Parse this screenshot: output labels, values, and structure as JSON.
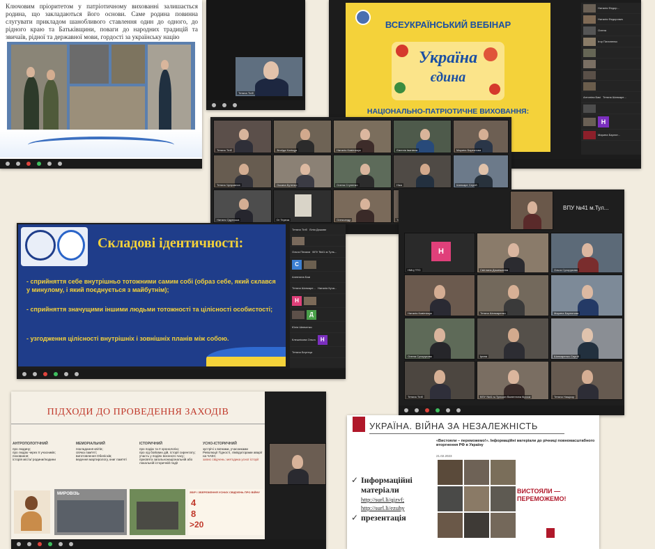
{
  "shot1": {
    "paragraph": "Ключовим пріоритетом у патріотичному вихованні залишається родина, що закладаються його основи. Саме родина повинна слугувати прикладом шанобливого ставлення один до одного, до рідного краю та Батьківщини, поваги до народних традицій та звичаїв, рідної та державної мови, гордості за українську націю"
  },
  "shot2": {
    "title": "ВСЕУКРАЇНСЬКИЙ ВЕБІНАР",
    "ukraine": "Україна",
    "edyna": "єдина",
    "subtitle": "НАЦІОНАЛЬНО-ПАТРІОТИЧНЕ ВИХОВАННЯ:",
    "side_names": [
      "Наталія Федор...",
      "Наталія Федорович",
      "Олена",
      "Ігор Пилипенко",
      "Антоніна Бакі",
      "Тетяна Шинкаре...",
      "Марина Бареят..."
    ],
    "avatar_letter": "Н"
  },
  "shot3": {
    "names": [
      "Тетяна Тігіб",
      "Зінаїда Коліщук",
      "Наталія Ковінчіжук",
      "Євгенія Іванівна",
      "Марина Бареятсва",
      "Тетяна Чупровлох",
      "Оксана Бутенко",
      "Олена Ступенко",
      "Ніка",
      "Шинкаре Сергій",
      "Глухівський",
      "Наталя Одунська",
      "Dr Тереза",
      "Олександр",
      "Тетяна Нищікор"
    ]
  },
  "shot4": {
    "heading": "Складові ідентичності:",
    "bullets": [
      "- сприйняття себе внутрішньо тотожними самим собі (образ себе, який склався у минулому, і який поєднується з майбутнім);",
      "- сприйняття значущими іншими людьми тотожності та цілісності особистості;",
      "- узгодження цілісності внутрішніх і зовнішніх планів між собою."
    ],
    "side_names": [
      "Тетяна Тігіб",
      "Лілія Дяшова",
      "Ольга Пінзаха",
      "ВПУ №41 м.Туль...",
      "Алевтина Бакі",
      "Тетяна Шинкаре...",
      "Наталія Куча...",
      "Юлія Шевченко",
      "Клешнікова Ольга",
      "Тетяна Бертеца"
    ],
    "avatar_c": "С",
    "avatar_n": "Н",
    "avatar_d": "Д",
    "avatar_n2": "Н"
  },
  "shot5": {
    "top_title": "ВПУ №41 м.Тул...",
    "avatar_letter": "Н",
    "names": [
      "НМЦ ПТО",
      "Світлана Дяшешанна",
      "Ольга Сухорукова",
      "Наталія Ковінчіжук",
      "Тетяна Шинкаренко",
      "Марина Бареятсва",
      "Олена Сухорукова",
      "Ірина",
      "Шинкаренко Сергій",
      "Тетяна Тігіб",
      "ВПУ №41 м.Тульчин Валентина Кіроскі",
      "Тетяна Нищікор"
    ]
  },
  "shot6": {
    "title": "ПІДХОДИ ДО ПРОВЕДЕННЯ ЗАХОДІВ",
    "columns": [
      {
        "name": "АНТРОПОЛОГІЧНИЙ",
        "items": [
          "про людину;",
          "про людію через її учасників;",
          "поховання;",
          "історія міста/ родини/людини"
        ]
      },
      {
        "name": "МЕМОРІАЛЬНИЙ",
        "items": [
          "покладання квітів;",
          "свічка пам'яті;",
          "виготовлення Обелісків;",
          "ведення мартирологу, книг пам'яті"
        ]
      },
      {
        "name": "ІСТОРИЧНИЙ",
        "items": [
          "про подію та її хронологію;",
          "про хід бойових дій, історії сирентату;",
          "участь у подіях воєнного часу;",
          "присвята загальнонаціональній або локальній історичній події"
        ]
      },
      {
        "name": "УСНО-ІСТОРИЧНИЙ",
        "items": [
          "зустрічі з воїнами, учасниками Революції Гідності, ліквідаторами аварії на ЧАЕС",
          "запис свідчень: методика усної історії"
        ]
      }
    ],
    "banner": "ЗБІР І ЗБЕРЕЖЕННЯ УСНИХ СВІДЧЕНЬ ПРО ВІЙНУ",
    "big_numbers": [
      "4",
      "8",
      ">20"
    ],
    "photo_caption": "МИРОВІЗЬ"
  },
  "shot7": {
    "title": "УКРАЇНА. ВІЙНА ЗА НЕЗАЛЕЖНІСТЬ",
    "header_small": "«Вистояли – переможемо!». Інформаційні матеріали до річниці повномасштабного вторгнення РФ в Україну",
    "date": "21.02.2023",
    "item1": "Інформаційні матеріали",
    "link1": "http://surl.li/qjzvf;",
    "link2": "http://surl.li/ezuhy",
    "item2": "презентація",
    "poster_text": "ВИСТОЯЛИ — ПЕРЕМОЖЕМО!"
  }
}
